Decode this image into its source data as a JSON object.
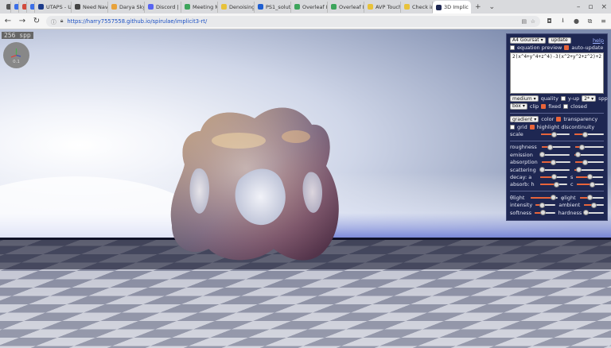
{
  "browser": {
    "tabs": [
      {
        "label": "",
        "color": "#555555"
      },
      {
        "label": "",
        "color": "#3b6ee8"
      },
      {
        "label": "",
        "color": "#d24b3c"
      },
      {
        "label": "",
        "color": "#3b6ee8"
      },
      {
        "label": "UTAPS - Uni",
        "color": "#1b3a8a"
      },
      {
        "label": "Need Navig",
        "color": "#444444"
      },
      {
        "label": "Darya Skye",
        "color": "#e8a23a"
      },
      {
        "label": "Discord | Bo",
        "color": "#5865f2"
      },
      {
        "label": "Meeting Me",
        "color": "#3da55c"
      },
      {
        "label": "Denoising I",
        "color": "#e8c23a"
      },
      {
        "label": "PS1_solutio",
        "color": "#1f5fd1"
      },
      {
        "label": "Overleaf Exam",
        "color": "#3da55c"
      },
      {
        "label": "Overleaf Exam",
        "color": "#3da55c"
      },
      {
        "label": "AVP Touchp",
        "color": "#e8c23a"
      },
      {
        "label": "Check in - 3",
        "color": "#e8c23a"
      }
    ],
    "active_tab": {
      "label": "3D Implic",
      "close": "×",
      "color": "#1e2752"
    },
    "new_tab": "+",
    "tab_menu": "⌄",
    "window_controls": {
      "minimize": "–",
      "maximize": "▫",
      "close": "×"
    },
    "url_host": "https://harry7557558.github.io",
    "url_path": "/spirulae/implicit3-rt/"
  },
  "viewport": {
    "spp_badge": "256 spp",
    "gizmo_value": "0.1"
  },
  "panel": {
    "function_select": "A4 Goursat",
    "update_button": "update",
    "help_link": "help",
    "equation_preview_label": "equation preview",
    "equation_preview_checked": false,
    "auto_update_label": "auto-update",
    "auto_update_checked": true,
    "equation_text": "2(x^4+y^4+z^4)-3(x^2+y^2+z^2)+2",
    "quality_select": "medium",
    "quality_label": "quality",
    "y_up_label": "y-up",
    "y_up_checked": false,
    "spp_select": "2*",
    "spp_label": "spp",
    "clip_select": "box",
    "clip_label": "clip",
    "fixed_label": "fixed",
    "fixed_checked": true,
    "closed_label": "closed",
    "closed_checked": false,
    "color_select": "gradient",
    "color_label": "color",
    "transparency_label": "transparency",
    "transparency_checked": true,
    "grid_label": "grid",
    "grid_checked": false,
    "highlight_label": "highlight discontinuity",
    "highlight_checked": true,
    "scale_label": "scale",
    "scale_value": 0.45,
    "scale2_value": 0.35,
    "roughness_label": "roughness",
    "roughness_value": 0.3,
    "roughness2_value": 0.25,
    "emission_label": "emission",
    "emission_value": 0.05,
    "emission2_value": 0.1,
    "absorption_label": "absorption",
    "absorption_value": 0.4,
    "absorption2_value": 0.35,
    "scattering_label": "scattering",
    "scattering_value": 0.05,
    "scattering2_value": 0.15,
    "decay_label": "decay: a",
    "decay_s_label": "s",
    "decay_a_value": 0.5,
    "decay_s_value": 0.5,
    "absorb_label": "absorb: h",
    "absorb_c_label": "c",
    "absorb_h_value": 0.6,
    "absorb_c_value": 0.6,
    "theta_label": "θlight",
    "phi_label": "φlight",
    "theta_value": 0.85,
    "phi_value": 0.4,
    "intensity_label": "intensity",
    "ambient_label": "ambient",
    "intensity_value": 0.35,
    "ambient_value": 0.5,
    "softness_label": "softness",
    "hardness_label": "hardness",
    "softness_value": 0.4,
    "hardness_value": 0.1
  },
  "colors": {
    "panel_bg": "#1e2752",
    "accent": "#e8643a"
  }
}
